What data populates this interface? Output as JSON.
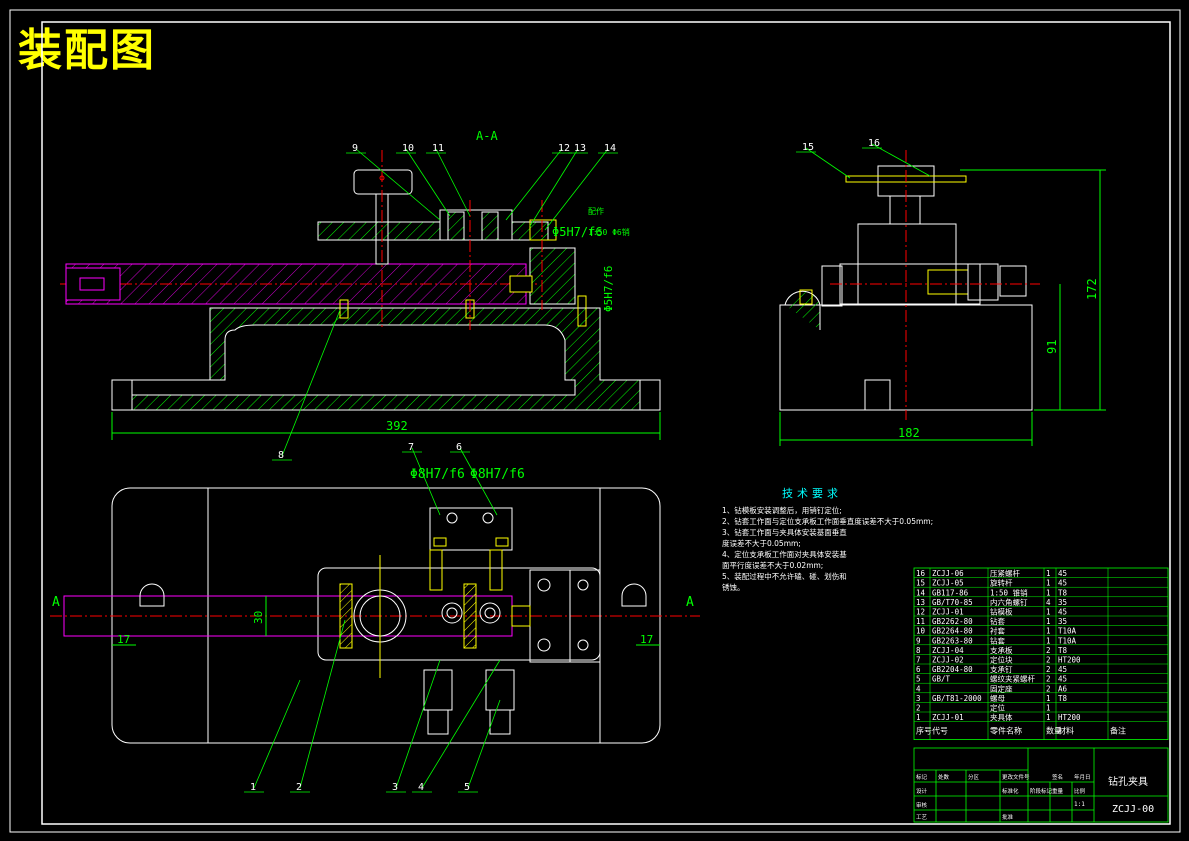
{
  "title": "装配图",
  "section_label": "A-A",
  "section_mark_left": "A",
  "section_mark_right": "A",
  "colors": {
    "outline": "#ffffff",
    "green": "#00ff00",
    "magenta": "#ff00ff",
    "yellow": "#ffff00",
    "cyan": "#00ffff",
    "red": "#ff0000"
  },
  "balloons": [
    "1",
    "2",
    "3",
    "4",
    "5",
    "6",
    "7",
    "8",
    "9",
    "10",
    "11",
    "12",
    "13",
    "14",
    "15",
    "16"
  ],
  "dimensions": {
    "length_392": "392",
    "width_182": "182",
    "height_172": "172",
    "height_91": "91",
    "fit_5": "Φ5H7/f6",
    "fit_8a": "Φ8H7/f6",
    "fit_8b": "Φ8H7/f6",
    "fit_vert": "Φ5H7/f6",
    "d30": "30",
    "d17a": "17",
    "d17b": "17",
    "taper_note_1": "1:50  Φ6销",
    "taper_note_2": "配作"
  },
  "tech_requirements": {
    "heading": "技术要求",
    "items": [
      "1、钻模板安装调整后，用销钉定位;",
      "2、钻套工作面与定位支承板工作面垂直度误差不大于0.05mm;",
      "3、钻套工作面与夹具体安装基面垂直",
      "度误差不大于0.05mm;",
      "4、定位支承板工作面对夹具体安装基",
      "面平行度误差不大于0.02mm;",
      "5、装配过程中不允许磕、碰、划伤和",
      "锈蚀。"
    ]
  },
  "parts_list": {
    "headers": [
      "序号",
      "代号",
      "零件名称",
      "数量",
      "材料",
      "备注"
    ],
    "rows": [
      [
        "16",
        "ZCJJ-06",
        "压紧螺杆",
        "1",
        "45",
        ""
      ],
      [
        "15",
        "ZCJJ-05",
        "旋转杆",
        "1",
        "45",
        ""
      ],
      [
        "14",
        "GB117-86",
        "1:50 锥销",
        "1",
        "T8",
        ""
      ],
      [
        "13",
        "GB/T70-85",
        "内六角螺钉",
        "4",
        "35",
        ""
      ],
      [
        "12",
        "ZCJJ-01",
        "钻模板",
        "1",
        "45",
        ""
      ],
      [
        "11",
        "GB2262-80",
        "钻套",
        "1",
        "35",
        ""
      ],
      [
        "10",
        "GB2264-80",
        "衬套",
        "1",
        "T10A",
        ""
      ],
      [
        "9",
        "GB2263-80",
        "钻套",
        "1",
        "T10A",
        ""
      ],
      [
        "8",
        "ZCJJ-04",
        "支承板",
        "2",
        "T8",
        ""
      ],
      [
        "7",
        "ZCJJ-02",
        "定位块",
        "2",
        "HT200",
        ""
      ],
      [
        "6",
        "GB2204-80",
        "支承钉",
        "2",
        "45",
        ""
      ],
      [
        "5",
        "GB/T",
        "螺纹夹紧螺杆",
        "2",
        "45",
        ""
      ],
      [
        "4",
        "",
        "固定座",
        "2",
        "A6",
        ""
      ],
      [
        "3",
        "GB/T81-2000",
        "螺母",
        "1",
        "T8",
        ""
      ],
      [
        "2",
        "",
        "定位",
        "1",
        "",
        ""
      ],
      [
        "1",
        "ZCJJ-01",
        "夹具体",
        "1",
        "HT200",
        ""
      ]
    ]
  },
  "title_block": {
    "name": "钻孔夹具",
    "code": "ZCJJ-00",
    "labels": [
      "标记",
      "处数",
      "分区",
      "更改文件号",
      "签名",
      "年月日",
      "设计",
      "标准化",
      "审核",
      "工艺",
      "批准",
      "阶段标记",
      "重量",
      "比例"
    ],
    "scale": "1:1"
  }
}
